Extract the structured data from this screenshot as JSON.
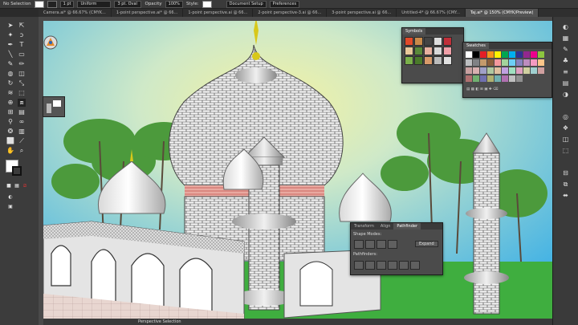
{
  "control_bar": {
    "selection_label": "No Selection",
    "stroke_value": "1 pt",
    "brush_label": "Uniform",
    "brush_size": "3 pt. Oval",
    "opacity_label": "Opacity",
    "opacity_value": "100%",
    "style_label": "Style:",
    "doc_setup": "Document Setup",
    "preferences": "Preferences"
  },
  "doc_tabs": [
    {
      "label": "Camera.ai* @ 66.67% (CMYK..."
    },
    {
      "label": "1-point perspective.ai* @ 66..."
    },
    {
      "label": "1-point perspective.ai @ 66..."
    },
    {
      "label": "2-point perspective-3.ai @ 66..."
    },
    {
      "label": "3-point perspective.ai @ 66..."
    },
    {
      "label": "Untitled-4* @ 66.67% (CMY..."
    },
    {
      "label": "Taj.ai* @ 150% (CMYK/Preview)"
    }
  ],
  "symbols_panel": {
    "tab": "Symbols"
  },
  "swatches_panel": {
    "tab": "Swatches"
  },
  "pathfinder_panel": {
    "tabs": [
      "Transform",
      "Align",
      "Pathfinder"
    ],
    "shape_modes_label": "Shape Modes:",
    "expand_label": "Expand",
    "pathfinders_label": "Pathfinders:"
  },
  "status_bar": {
    "label": "Perspective Selection"
  },
  "colors": {
    "sky_top": "#4fb8e6",
    "sky_glow": "#f2f0a0",
    "grass": "#3fae3f",
    "accent_gold": "#d8c81a"
  }
}
